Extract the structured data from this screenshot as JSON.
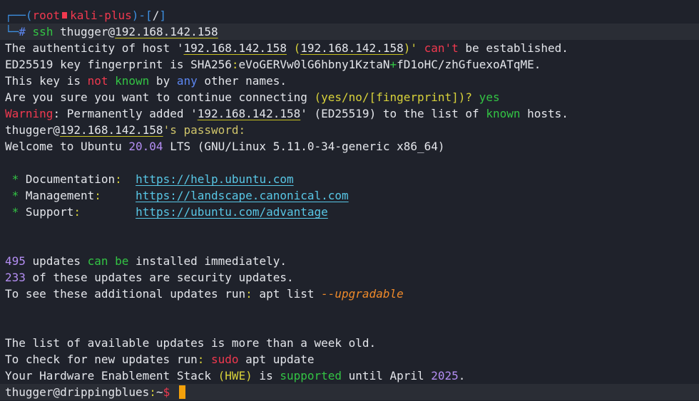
{
  "prompt": {
    "corner_top": "┌──",
    "user": "root",
    "host": "kali-plus",
    "cwd": "/",
    "corner_bottom": "└─",
    "hash": "#",
    "command": "ssh",
    "target_user": "thugger@",
    "target_ip": "192.168.142.158"
  },
  "auth": {
    "line1_a": "The authenticity of host '",
    "ip": "192.168.142.158",
    "paren_open": " (",
    "paren_close": ")'",
    "cant": " can't",
    "line1_b": " be established.",
    "fp_a": "ED25519 key fingerprint is SHA256",
    "fp_colon": ":",
    "fp_part1": "eVoGERVw0lG6hbny1KztaN",
    "fp_plus": "+",
    "fp_part2": "fD1oHC/zhGfuexoATqME",
    "fp_dot": ".",
    "key_a": "This key is ",
    "not": "not",
    "known": " known",
    "by": " by ",
    "any": "any",
    "other": " other names.",
    "confirm_a": "Are you sure you want to continue connecting ",
    "confirm_choices_open": "(yes/no/[fingerprint])?",
    "confirm_answer": " yes",
    "warning_label": "Warning",
    "warning_a": ": Permanently added '",
    "warning_b": "' (ED25519) to the list of ",
    "warning_known": "known",
    "warning_c": " hosts.",
    "pw_user": "thugger@",
    "pw_ip": "192.168.142.158",
    "pw_rest": "'s password:"
  },
  "welcome": {
    "a": "Welcome to Ubuntu ",
    "version": "20.04",
    "b": " LTS (GNU/Linux 5.11.0-34-generic x86_64)"
  },
  "links": [
    {
      "label": "Documentation",
      "pad": ":  ",
      "url": "https://help.ubuntu.com"
    },
    {
      "label": "Management",
      "pad": ":     ",
      "url": "https://landscape.canonical.com"
    },
    {
      "label": "Support",
      "pad": ":        ",
      "url": "https://ubuntu.com/advantage"
    }
  ],
  "updates": {
    "count1": "495",
    "a": " updates ",
    "can": "can",
    "be": " be",
    "b": " installed immediately.",
    "count2": "233",
    "c": " of these updates are security updates.",
    "d": "To see these additional updates run",
    "colon": ":",
    "e": " apt list ",
    "flag": "--upgradable"
  },
  "notice": {
    "line1": "The list of available updates is more than a week old.",
    "line2_a": "To check for new updates run",
    "line2_colon": ":",
    "sudo": " sudo",
    "line2_b": " apt update",
    "line3_a": "Your Hardware Enablement Stack ",
    "hwe": "(HWE)",
    "line3_b": " is ",
    "supported": "supported",
    "line3_c": " until April ",
    "year": "2025",
    "line3_d": "."
  },
  "remote_prompt": {
    "userhost": "thugger@drippingblues",
    "colon": ":",
    "path": "~",
    "dollar": "$"
  },
  "colors": {
    "background": "#1f222b",
    "text": "#e4e6eb",
    "prompt_blue": "#3d8fe0",
    "red": "#f0394f",
    "green": "#33c444",
    "purple": "#b48ef3",
    "yellow": "#d8d23a",
    "link": "#58c7e6",
    "cursor": "#f4a10b"
  }
}
